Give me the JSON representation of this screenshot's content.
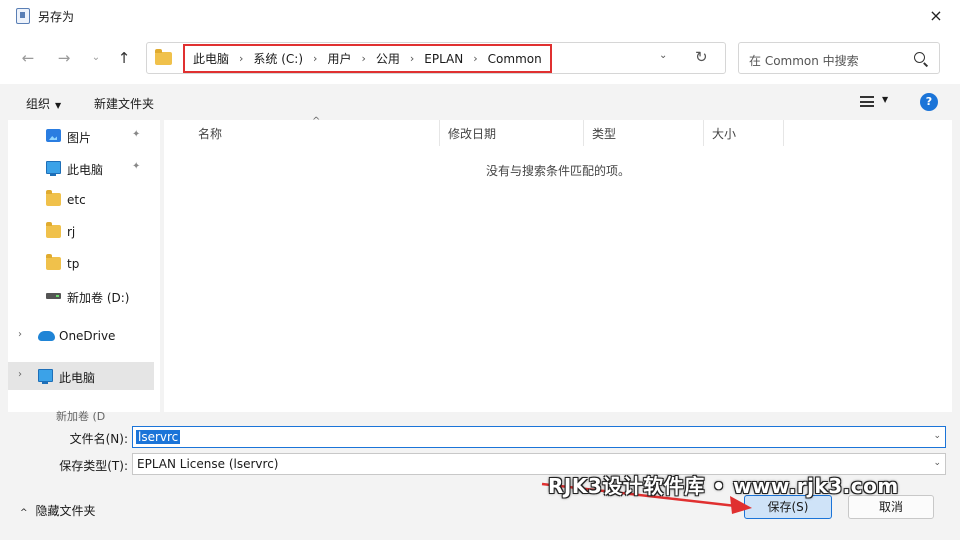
{
  "window": {
    "title": "另存为",
    "close_icon": "×"
  },
  "nav": {
    "back": "←",
    "forward": "→",
    "recent": "⌄",
    "up": "↑",
    "breadcrumbs": [
      "此电脑",
      "系统 (C:)",
      "用户",
      "公用",
      "EPLAN",
      "Common"
    ],
    "breadcrumb_separator": "›",
    "address_dropdown": "⌄",
    "refresh": "↻"
  },
  "search": {
    "placeholder": "在 Common 中搜索"
  },
  "toolbar": {
    "organize": "组织",
    "new_folder": "新建文件夹",
    "help": "?"
  },
  "sidebar": {
    "items": [
      {
        "label": "图片",
        "icon": "pictures-icon",
        "pinned": true
      },
      {
        "label": "此电脑",
        "icon": "computer-icon",
        "pinned": true
      },
      {
        "label": "etc",
        "icon": "folder-icon"
      },
      {
        "label": "rj",
        "icon": "folder-icon"
      },
      {
        "label": "tp",
        "icon": "folder-icon"
      },
      {
        "label": "新加卷 (D:)",
        "icon": "drive-icon"
      },
      {
        "label": "OneDrive",
        "icon": "cloud-icon"
      },
      {
        "label": "此电脑",
        "icon": "computer-icon",
        "selected": true
      }
    ],
    "pin_glyph": "📌",
    "chevron": "›",
    "cut_off_label": "新加卷 (D"
  },
  "file_list": {
    "columns": [
      "名称",
      "修改日期",
      "类型",
      "大小"
    ],
    "sort_indicator": "^",
    "empty_message": "没有与搜索条件匹配的项。"
  },
  "form": {
    "filename_label": "文件名(N):",
    "filename_value": "lservrc",
    "filetype_label": "保存类型(T):",
    "filetype_value": "EPLAN License (lservrc)",
    "dropdown_caret": "⌄"
  },
  "footer": {
    "hide_folders": "隐藏文件夹",
    "hide_chevron": "^",
    "save": "保存(S)",
    "cancel": "取消"
  },
  "annotation": {
    "watermark": "RJK3设计软件库 • www.rjk3.com",
    "highlight_color": "#e03030",
    "arrow_color": "#e03030"
  },
  "colors": {
    "accent": "#1b74d8",
    "folder": "#f0c14b"
  }
}
